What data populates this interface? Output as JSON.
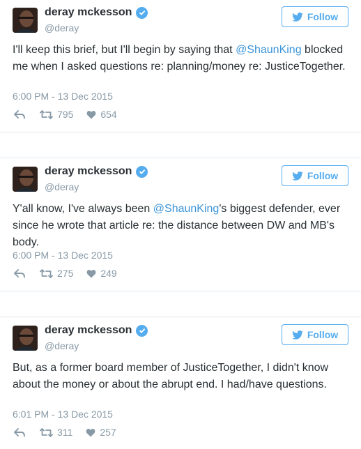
{
  "colors": {
    "accent": "#55acee",
    "link": "#3b94d9",
    "muted": "#8899a6",
    "text": "#292f33"
  },
  "icons": {
    "verified": "verified-badge-icon",
    "follow": "twitter-bird-icon",
    "reply": "reply-icon",
    "retweet": "retweet-icon",
    "like": "heart-icon"
  },
  "tweets": [
    {
      "author": "deray mckesson",
      "handle": "@deray",
      "follow_label": "Follow",
      "text": {
        "before": "I'll keep this brief, but I'll begin by saying that ",
        "mention": "@ShaunKing",
        "after": " blocked me when I asked questions re: planning/money re: JusticeTogether."
      },
      "timestamp": "6:00 PM - 13 Dec 2015",
      "retweets": "795",
      "likes": "654"
    },
    {
      "author": "deray mckesson",
      "handle": "@deray",
      "follow_label": "Follow",
      "text": {
        "before": "Y'all know, I've always been ",
        "mention": "@ShaunKing",
        "after": "'s biggest defender, ever since he wrote that article re: the distance between DW and MB's body."
      },
      "timestamp": "6:00 PM - 13 Dec 2015",
      "retweets": "275",
      "likes": "249"
    },
    {
      "author": "deray mckesson",
      "handle": "@deray",
      "follow_label": "Follow",
      "text": {
        "before": "But, as a former board member of JusticeTogether, I didn't know about the money or about the abrupt end. I had/have questions.",
        "mention": "",
        "after": ""
      },
      "timestamp": "6:01 PM - 13 Dec 2015",
      "retweets": "311",
      "likes": "257"
    }
  ]
}
